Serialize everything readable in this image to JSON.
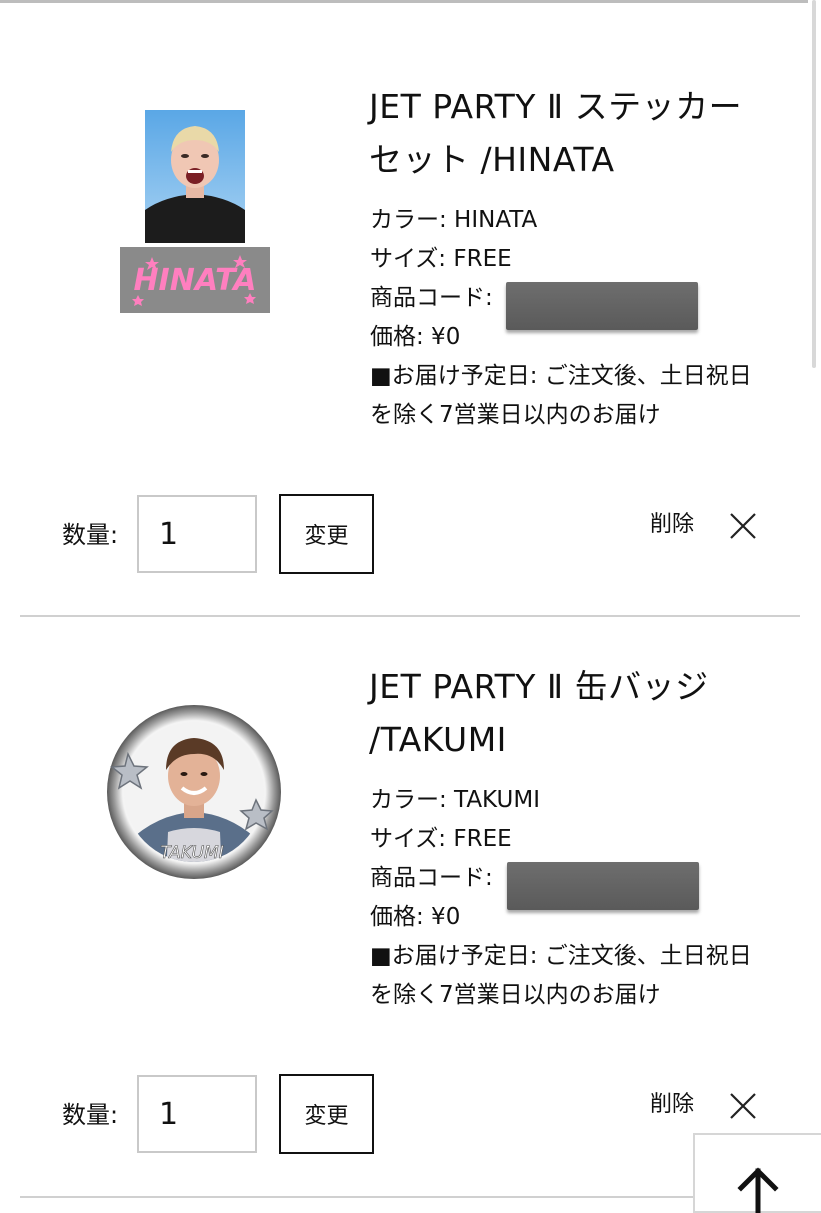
{
  "items": [
    {
      "title": "JET PARTY Ⅱ ステッカーセット /HINATA",
      "color": "カラー: HINATA",
      "size": "サイズ: FREE",
      "code_label": "商品コード:",
      "price": "価格: ¥0",
      "delivery": "■お届け予定日: ご注文後、土日祝日を除く7営業日以内のお届け",
      "plate_text": "HINATA",
      "quantity_label": "数量:",
      "quantity": "1",
      "change_label": "変更",
      "delete_label": "削除"
    },
    {
      "title": "JET PARTY Ⅱ 缶バッジ /TAKUMI",
      "color": "カラー: TAKUMI",
      "size": "サイズ: FREE",
      "code_label": "商品コード:",
      "price": "価格: ¥0",
      "delivery": "■お届け予定日: ご注文後、土日祝日を除く7営業日以内のお届け",
      "badge_text": "TAKUMI",
      "quantity_label": "数量:",
      "quantity": "1",
      "change_label": "変更",
      "delete_label": "削除"
    }
  ],
  "colors": {
    "plate_bg": "#8a8a8a",
    "plate_text": "#ff7fbf",
    "redaction": "#666666"
  },
  "icons": {
    "delete": "close-icon",
    "back_to_top": "arrow-up-icon"
  }
}
